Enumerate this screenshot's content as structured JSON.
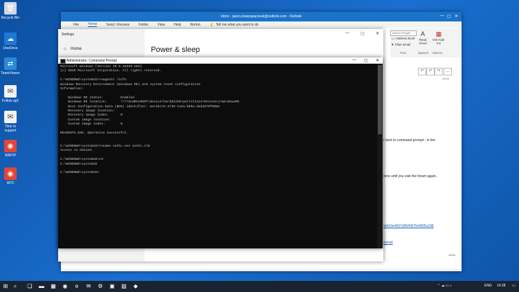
{
  "desktop": {
    "icons": [
      {
        "label": "Recycle Bin",
        "glyph": "🗑"
      },
      {
        "label": "OneDrive",
        "glyph": "☁"
      },
      {
        "label": "TeamViewer",
        "glyph": "⇄"
      },
      {
        "label": "Follow up2",
        "glyph": "✉"
      },
      {
        "label": "Time to",
        "label2": "support",
        "glyph": "✉"
      },
      {
        "label": "WINTP",
        "glyph": "◉"
      },
      {
        "label": "WTF",
        "glyph": "◉"
      }
    ]
  },
  "outlook": {
    "title": "Inbox - jason.inwarspacesuk@outlook.com - Outlook",
    "menu": [
      "File",
      "Home",
      "Send / Receive",
      "Folder",
      "View",
      "Help",
      "Norton"
    ],
    "tell_me": "Tell me what you want to do",
    "ribbon": {
      "search_placeholder": "Search People",
      "address_book": "Address Book",
      "filter_email": "Filter Email",
      "find_label": "Find",
      "read_aloud": "Read Aloud",
      "speech_label": "Speech",
      "get_addins": "Get Add-ins",
      "addins_label": "Add-ins"
    },
    "time": "13:44",
    "body_lines": [
      "'t boot to command prompt - in the",
      "tions until you visit the forum again."
    ],
    "links": [
      "6dd16e4567d954067fe5805a188",
      "eid=all"
    ],
    "zoom": "100%"
  },
  "settings": {
    "title": "Settings",
    "home_label": "Home",
    "heading": "Power & sleep"
  },
  "cmd": {
    "title": "Administrator: Command Prompt",
    "lines": [
      "Microsoft Windows [Version 10.0.18363.592]",
      "(c) 2019 Microsoft Corporation. All rights reserved.",
      "",
      "C:\\WINDOWS\\system32>reagentc /info",
      "Windows Recovery Environment (Windows RE) and system reset configuration",
      "Information:",
      "",
      "    Windows RE status:         Enabled",
      "    Windows RE location:       \\\\?\\GLOBALROOT\\device\\harddisk0\\partition4\\Recovery\\WindowsRE",
      "    Boot Configuration Data (BCD) identifier: aec1bc7a-4739-11ea-b55a-ded3d79f088e",
      "    Recovery image location:",
      "    Recovery image index:      0",
      "    Custom image location:",
      "    Custom image index:        0",
      "",
      "REAGENTC.EXE: Operation Successful.",
      "",
      "",
      "C:\\WINDOWS\\system32>rename sethc.exe sethc.old",
      "Access is denied.",
      "",
      "C:\\WINDOWS\\system32>cd",
      "C:\\WINDOWS\\system32",
      "",
      "C:\\WINDOWS\\system32>"
    ]
  },
  "taskbar": {
    "clock": "14:28",
    "lang": "ENG"
  }
}
